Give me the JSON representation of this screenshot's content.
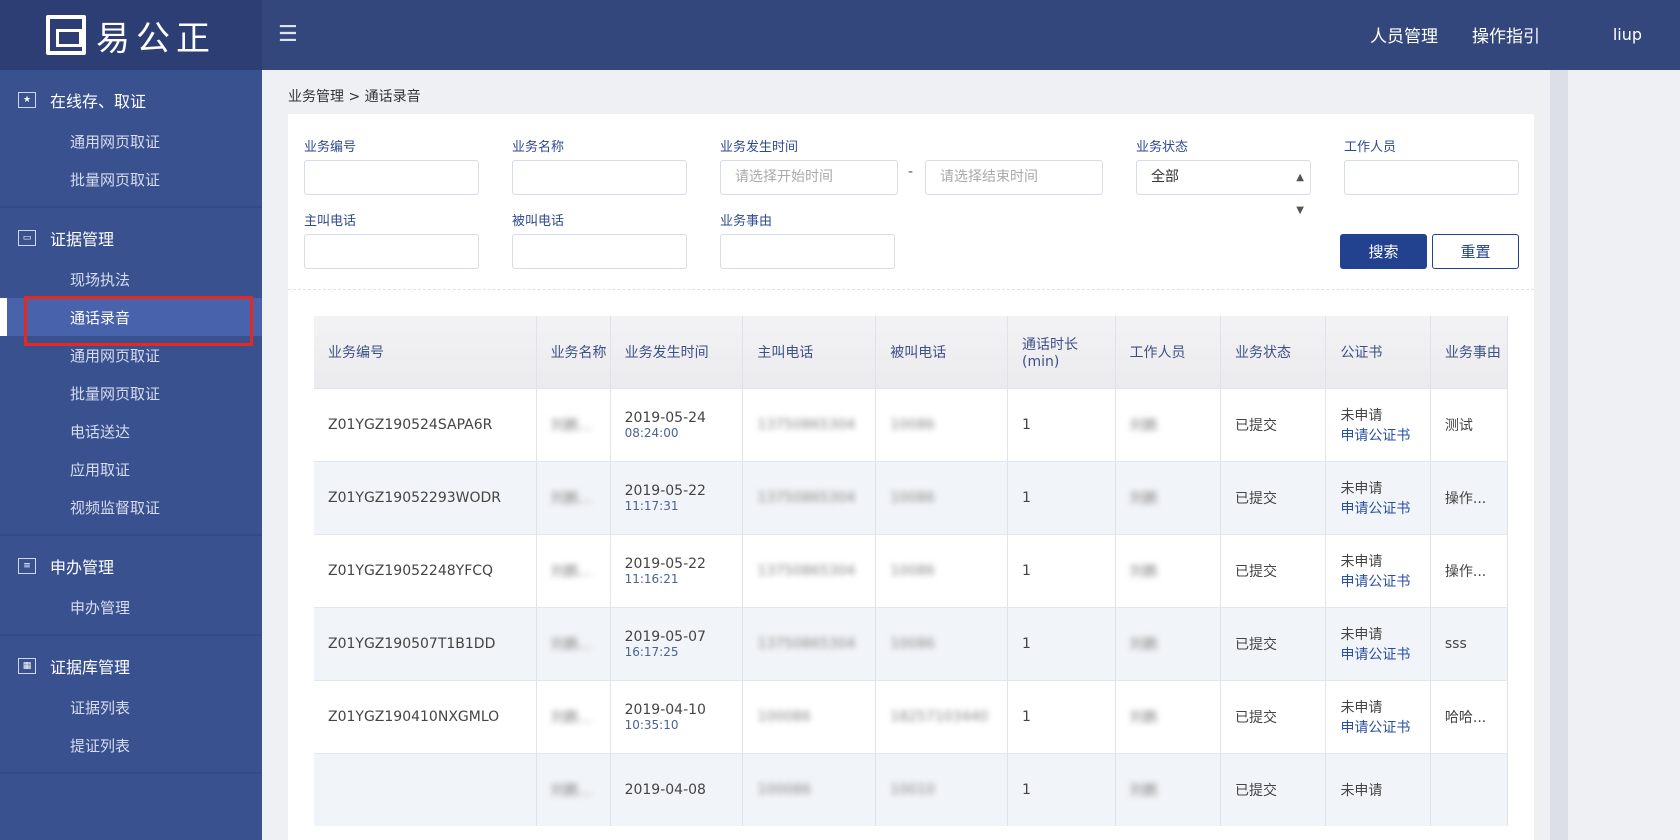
{
  "logo": {
    "text": "易公正"
  },
  "header": {
    "nav": [
      "人员管理",
      "操作指引"
    ],
    "user": "liup"
  },
  "sidebar": {
    "groups": [
      {
        "title": "在线存、取证",
        "icon": "browser-star-icon",
        "items": [
          "通用网页取证",
          "批量网页取证"
        ]
      },
      {
        "title": "证据管理",
        "icon": "archive-box-icon",
        "items": [
          "现场执法",
          "通话录音",
          "通用网页取证",
          "批量网页取证",
          "电话送达",
          "应用取证",
          "视频监督取证"
        ]
      },
      {
        "title": "申办管理",
        "icon": "certificate-icon",
        "items": [
          "申办管理"
        ]
      },
      {
        "title": "证据库管理",
        "icon": "grid-apps-icon",
        "items": [
          "证据列表",
          "提证列表"
        ]
      }
    ],
    "active": "通话录音"
  },
  "breadcrumb": "业务管理 > 通话录音",
  "filters": {
    "biz_no": "业务编号",
    "biz_name": "业务名称",
    "biz_time": "业务发生时间",
    "start_ph": "请选择开始时间",
    "end_ph": "请选择结束时间",
    "dash": "-",
    "status": "业务状态",
    "status_value": "全部",
    "staff": "工作人员",
    "caller": "主叫电话",
    "callee": "被叫电话",
    "reason": "业务事由",
    "search": "搜索",
    "reset": "重置"
  },
  "table": {
    "columns": [
      "业务编号",
      "业务名称",
      "业务发生时间",
      "主叫电话",
      "被叫电话",
      "通话时长\n(min)",
      "工作人员",
      "业务状态",
      "公证书",
      "业务事由"
    ],
    "rows": [
      {
        "id": "Z01YGZ190524SAPA6R",
        "name": "刘鹏...",
        "date": "2019-05-24",
        "time": "08:24:00",
        "caller": "13750865304",
        "callee": "10086",
        "dur": "1",
        "staff": "刘鹏",
        "status": "已提交",
        "cert": "未申请",
        "cert_link": "申请公证书",
        "reason": "测试"
      },
      {
        "id": "Z01YGZ19052293WODR",
        "name": "刘鹏...",
        "date": "2019-05-22",
        "time": "11:17:31",
        "caller": "13750865304",
        "callee": "10086",
        "dur": "1",
        "staff": "刘鹏",
        "status": "已提交",
        "cert": "未申请",
        "cert_link": "申请公证书",
        "reason": "操作..."
      },
      {
        "id": "Z01YGZ19052248YFCQ",
        "name": "刘鹏...",
        "date": "2019-05-22",
        "time": "11:16:21",
        "caller": "13750865304",
        "callee": "10086",
        "dur": "1",
        "staff": "刘鹏",
        "status": "已提交",
        "cert": "未申请",
        "cert_link": "申请公证书",
        "reason": "操作..."
      },
      {
        "id": "Z01YGZ190507T1B1DD",
        "name": "刘鹏...",
        "date": "2019-05-07",
        "time": "16:17:25",
        "caller": "13750865304",
        "callee": "10086",
        "dur": "1",
        "staff": "刘鹏",
        "status": "已提交",
        "cert": "未申请",
        "cert_link": "申请公证书",
        "reason": "sss"
      },
      {
        "id": "Z01YGZ190410NXGMLO",
        "name": "刘鹏...",
        "date": "2019-04-10",
        "time": "10:35:10",
        "caller": "100086",
        "callee": "18257103440",
        "dur": "1",
        "staff": "刘鹏",
        "status": "已提交",
        "cert": "未申请",
        "cert_link": "申请公证书",
        "reason": "哈哈..."
      },
      {
        "id": "",
        "name": "刘鹏...",
        "date": "2019-04-08",
        "time": "",
        "caller": "100086",
        "callee": "10010",
        "dur": "1",
        "staff": "刘鹏",
        "status": "已提交",
        "cert": "未申请",
        "cert_link": "",
        "reason": ""
      }
    ]
  },
  "colors": {
    "header": "#34477c",
    "sidebar": "#3a5190",
    "primary": "#22418e",
    "highlight": "#e8281f"
  }
}
